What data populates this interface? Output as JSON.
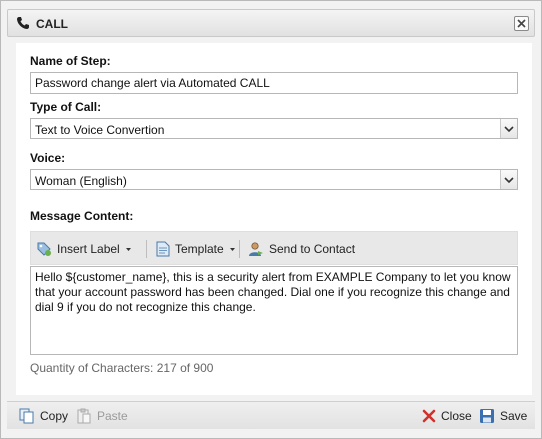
{
  "dialog": {
    "title": "CALL",
    "icons": {
      "title": "phone-icon",
      "close": "close-icon"
    }
  },
  "form": {
    "step_name_label": "Name of Step:",
    "step_name_value": "Password change alert via Automated CALL",
    "call_type_label": "Type of Call:",
    "call_type_value": "Text to Voice Convertion",
    "voice_label": "Voice:",
    "voice_value": "Woman (English)",
    "message_label": "Message Content:"
  },
  "toolbar": {
    "insert_label": "Insert Label",
    "template": "Template",
    "send_to_contact": "Send to Contact"
  },
  "message": {
    "text": "Hello ${customer_name}, this is a security alert from EXAMPLE Company to let you know that your account password has been changed. Dial one if you recognize this change and dial 9 if you do not recognize this change.",
    "char_count": "Quantity of Characters: 217 of 900"
  },
  "footer": {
    "copy": "Copy",
    "paste": "Paste",
    "close": "Close",
    "save": "Save"
  },
  "colors": {
    "close_red": "#d0312d",
    "save_blue": "#3a6fb0",
    "icon_gray": "#6b6b6b"
  }
}
